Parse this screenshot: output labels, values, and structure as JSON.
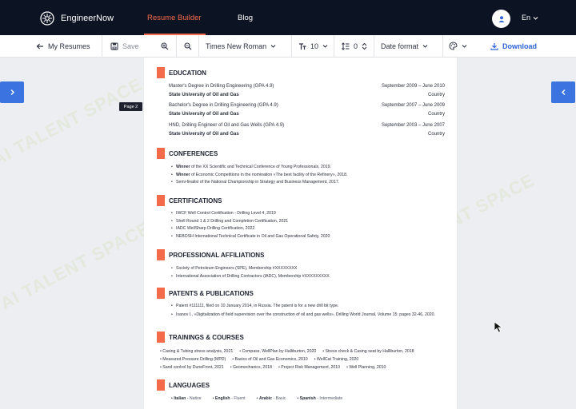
{
  "nav": {
    "brand": "EngineerNow",
    "links": [
      "Resume Builder",
      "Blog"
    ],
    "language": "En"
  },
  "toolbar": {
    "back": "My Resumes",
    "save": "Save",
    "font": "Times New Roman",
    "font_size": "10",
    "line_spacing": "0",
    "date_format": "Date format",
    "download": "Download"
  },
  "page_badge": "Page 2",
  "watermark": "AI TALENT SPACE",
  "resume": {
    "education": {
      "title": "EDUCATION",
      "items": [
        {
          "degree": "Master's Degree in Drilling Engineering (GPA 4.9)",
          "school": "State University of Oil and Gas",
          "dates": "September 2009 – June 2010",
          "country": "Country"
        },
        {
          "degree": "Bachelor's Degree in Drilling Engineering (GPA 4.9)",
          "school": "State University of Oil and Gas",
          "dates": "September 2007 – June 2009",
          "country": "Country"
        },
        {
          "degree": "HND, Drilling Engineer of Oil and Gas Wells (GPA 4.9)",
          "school": "State University of Oil and Gas",
          "dates": "September 2003 – June 2007",
          "country": "Country"
        }
      ]
    },
    "conferences": {
      "title": "CONFERENCES",
      "items": [
        {
          "bold": "Winner",
          "text": " of the XX Scientific and Technical Conference of Young Professionals, 2019."
        },
        {
          "bold": "Winner",
          "text": " of Economic Competitions in the nomination «The best facility of the Refinery», 2018."
        },
        {
          "bold": "",
          "text": "Semi-finalist of the National Championship in Strategy and Business Management, 2017."
        }
      ]
    },
    "certifications": {
      "title": "CERTIFICATIONS",
      "items": [
        "IWCF Well Control Certification - Drilling Level 4, 2019",
        "Shell Round 1 & 2 Drilling and Completion Certification, 2021",
        "IADC WellSharp Drilling Certification, 2022",
        "NEBOSH International Technical Certificate in Oil and Gas Operational Safety, 2020"
      ]
    },
    "affiliations": {
      "title": "PROFESSIONAL AFFILIATIONS",
      "items": [
        "Society of Petroleum Engineers (SPE), Membership #XXXXXXXX",
        "International Association of Drilling Contractors (IADC), Membership #XXXXXXXXX"
      ]
    },
    "patents": {
      "title": "PATENTS & PUBLICATIONS",
      "items": [
        "Patent #111111, filed on 10 January 2014, in Russia. The patent is for a new drill bit type.",
        "Ivanov I., «Digitalization of field supervision over the construction of oil and gas wells», Drilling World Journal, Volume 15: pages 32-46, 2020."
      ]
    },
    "trainings": {
      "title": "TRAININGS & COURSES",
      "rows": [
        [
          "Casing & Tubing stress analysis, 2021",
          "Compass, WellPlan by Halliburton, 2020",
          "Stress check & Casing seat by Halliburton, 2018"
        ],
        [
          "Measured Pressure Drilling (MPD)",
          "Basics of Oil and Gas Economics, 2010",
          "WellCat Training, 2020"
        ],
        [
          "Sand control by DuneFront, 2021",
          "Geomechanics, 2018",
          "Project Risk Management, 2010",
          "Well Planning, 2010"
        ]
      ]
    },
    "languages": {
      "title": "LANGUAGES",
      "items": [
        {
          "name": "Italian",
          "level": " - Native"
        },
        {
          "name": "English",
          "level": " - Fluent"
        },
        {
          "name": "Arabic",
          "level": " - Basic"
        },
        {
          "name": "Spanish",
          "level": " - Intermediate"
        }
      ]
    }
  }
}
